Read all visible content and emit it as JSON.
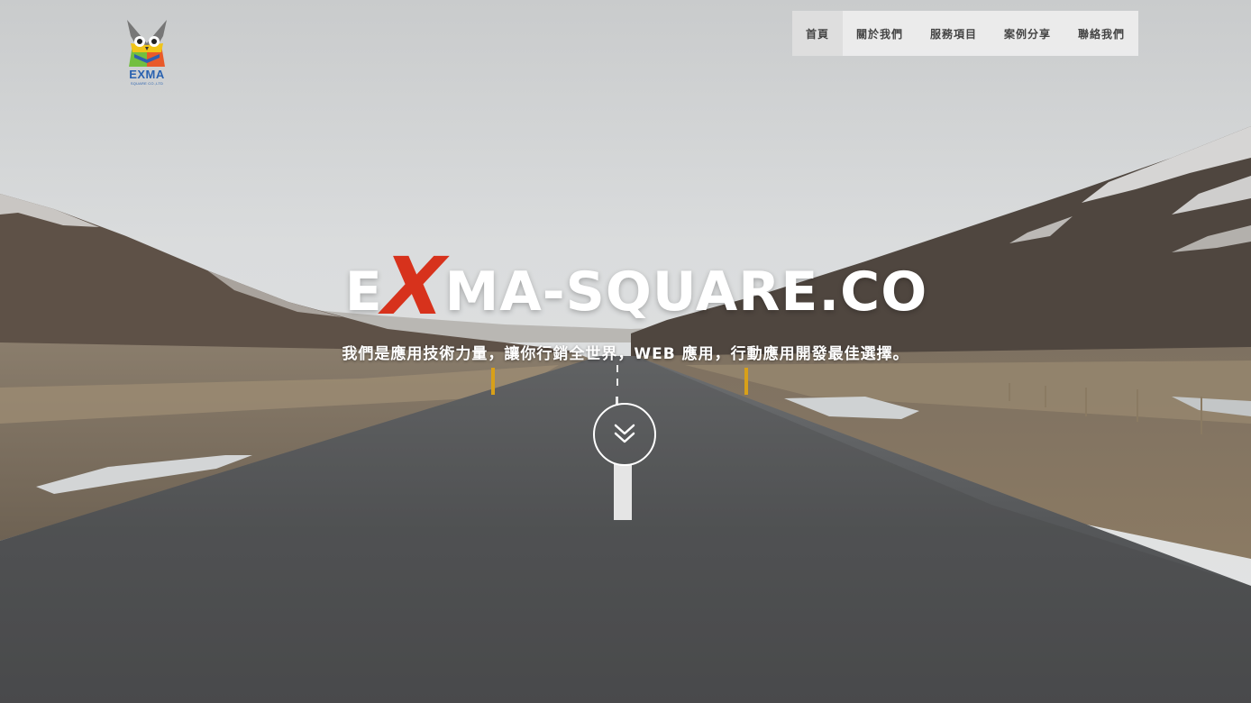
{
  "header": {
    "logo": {
      "text": "EXMA",
      "subtext": "SQUARE CO.,LTD"
    },
    "nav": [
      {
        "label": "首頁",
        "active": true
      },
      {
        "label": "關於我們",
        "active": false
      },
      {
        "label": "服務項目",
        "active": false
      },
      {
        "label": "案例分享",
        "active": false
      },
      {
        "label": "聯絡我們",
        "active": false
      }
    ]
  },
  "hero": {
    "brand_prefix": "E",
    "brand_x": "X",
    "brand_suffix": "MA-SQUARE.CO",
    "tagline": "我們是應用技術力量，讓你行銷全世界，WEB 應用，行動應用開發最佳選擇。",
    "scroll_icon": "double-chevron-down-icon"
  },
  "colors": {
    "accent": "#d7321c",
    "logo_blue": "#2a62b0",
    "nav_bg": "#eeeeee"
  }
}
